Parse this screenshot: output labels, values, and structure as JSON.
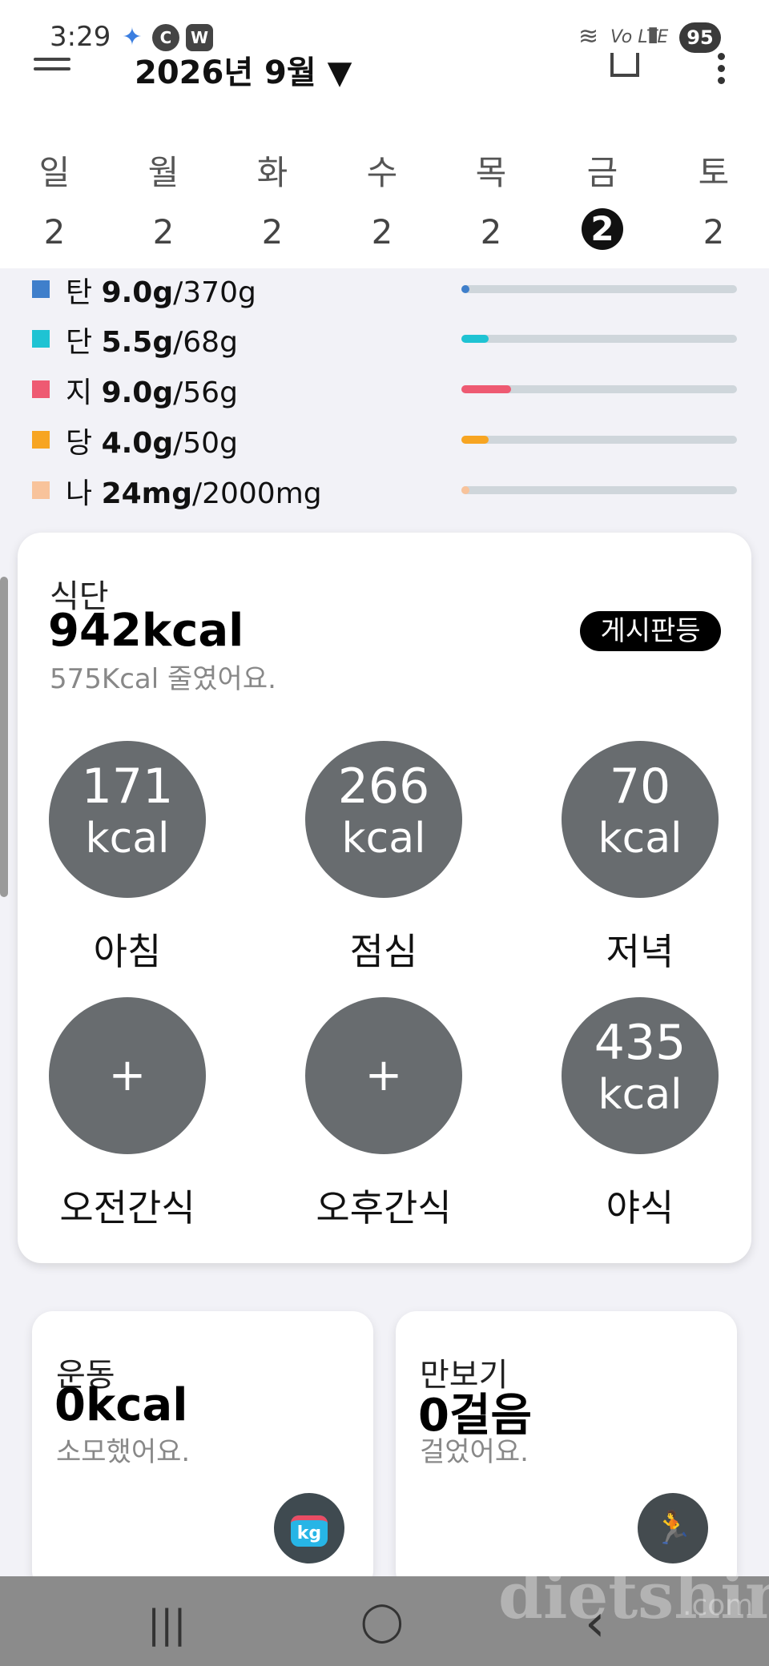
{
  "status": {
    "time": "3:29",
    "badges": [
      {
        "icon": "sparkle-icon",
        "label": "✦"
      },
      {
        "icon": "c-icon",
        "label": "C"
      },
      {
        "icon": "w-icon",
        "label": "W"
      }
    ],
    "network": "Vo LTE",
    "battery": "95"
  },
  "header": {
    "month": "2026년 9월",
    "dropdown_glyph": "▼"
  },
  "week": {
    "days": [
      "일",
      "월",
      "화",
      "수",
      "목",
      "금",
      "토"
    ],
    "dates": [
      "2",
      "2",
      "2",
      "2",
      "2",
      "2",
      "2"
    ],
    "selected_index": 5
  },
  "nutrients": [
    {
      "label": "탄",
      "amount": "9.0g",
      "goal": "/370g",
      "color": "#3f7fcb",
      "fraction": 0.03
    },
    {
      "label": "단",
      "amount": "5.5g",
      "goal": "/68g",
      "color": "#1fc3d3",
      "fraction": 0.1
    },
    {
      "label": "지",
      "amount": "9.0g",
      "goal": "/56g",
      "color": "#ee5a72",
      "fraction": 0.18
    },
    {
      "label": "당",
      "amount": "4.0g",
      "goal": "/50g",
      "color": "#f7a522",
      "fraction": 0.1
    },
    {
      "label": "나",
      "amount": "24mg",
      "goal": "/2000mg",
      "color": "#f8c39b",
      "fraction": 0.03
    }
  ],
  "meal_card": {
    "label": "식단",
    "value": "942kcal",
    "sub": "575Kcal 줄였어요.",
    "board_button": "게시판등",
    "meals": [
      {
        "name": "아침",
        "num": "171",
        "unit": "kcal"
      },
      {
        "name": "점심",
        "num": "266",
        "unit": "kcal"
      },
      {
        "name": "저녁",
        "num": "70",
        "unit": "kcal"
      },
      {
        "name": "오전간식",
        "num": "",
        "unit": "",
        "plus": "+"
      },
      {
        "name": "오후간식",
        "num": "",
        "unit": "",
        "plus": "+"
      },
      {
        "name": "야식",
        "num": "435",
        "unit": "kcal"
      }
    ]
  },
  "exercise_card": {
    "label": "운동",
    "value": "0kcal",
    "sub": "소모했어요.",
    "icon": "kettlebell-icon",
    "icon_text": "kg"
  },
  "steps_card": {
    "label": "만보기",
    "value": "0걸음",
    "sub": "걸었어요.",
    "icon": "runner-icon",
    "icon_text": "🏃"
  },
  "nav": {
    "recent": "|||",
    "home": "◯",
    "back": "‹"
  },
  "watermark": {
    "brand": "dietshin",
    "suffix": ".com"
  }
}
